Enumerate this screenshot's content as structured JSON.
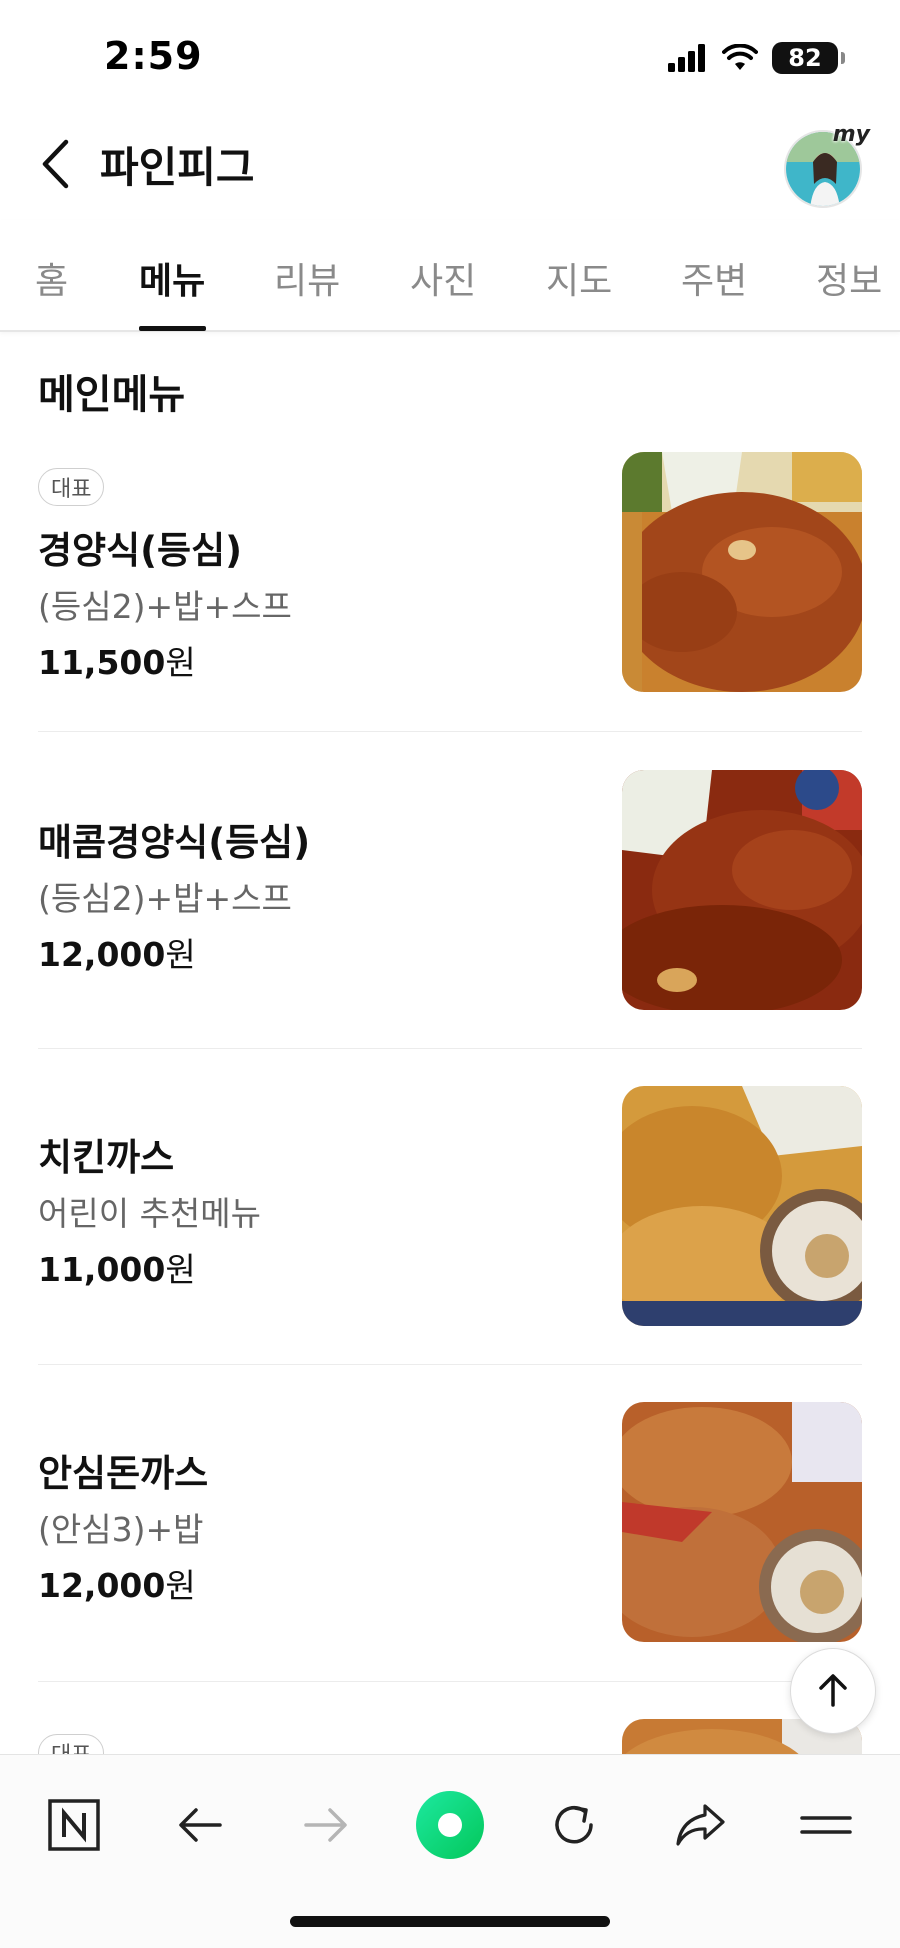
{
  "status_bar": {
    "time": "2:59",
    "battery": "82"
  },
  "header": {
    "title": "파인피그",
    "avatar_badge": "my"
  },
  "tabs": [
    {
      "label": "홈"
    },
    {
      "label": "메뉴",
      "active": true
    },
    {
      "label": "리뷰"
    },
    {
      "label": "사진"
    },
    {
      "label": "지도"
    },
    {
      "label": "주변"
    },
    {
      "label": "정보"
    }
  ],
  "section": {
    "title": "메인메뉴"
  },
  "menu_items": [
    {
      "badge": "대표",
      "name": "경양식(등심)",
      "desc": "(등심2)+밥+스프",
      "price": "11,500",
      "currency": "원"
    },
    {
      "badge": "",
      "name": "매콤경양식(등심)",
      "desc": "(등심2)+밥+스프",
      "price": "12,000",
      "currency": "원"
    },
    {
      "badge": "",
      "name": "치킨까스",
      "desc": "어린이 추천메뉴",
      "price": "11,000",
      "currency": "원"
    },
    {
      "badge": "",
      "name": "안심돈까스",
      "desc": "(안심3)+밥",
      "price": "12,000",
      "currency": "원"
    },
    {
      "badge": "대표"
    }
  ],
  "toolbar": {
    "items": [
      "naver-home",
      "back",
      "forward",
      "green-dot",
      "refresh",
      "share",
      "menu"
    ]
  },
  "colors": {
    "accent_green": "#03c75a",
    "text": "#111111",
    "muted": "#8a8a8a"
  }
}
